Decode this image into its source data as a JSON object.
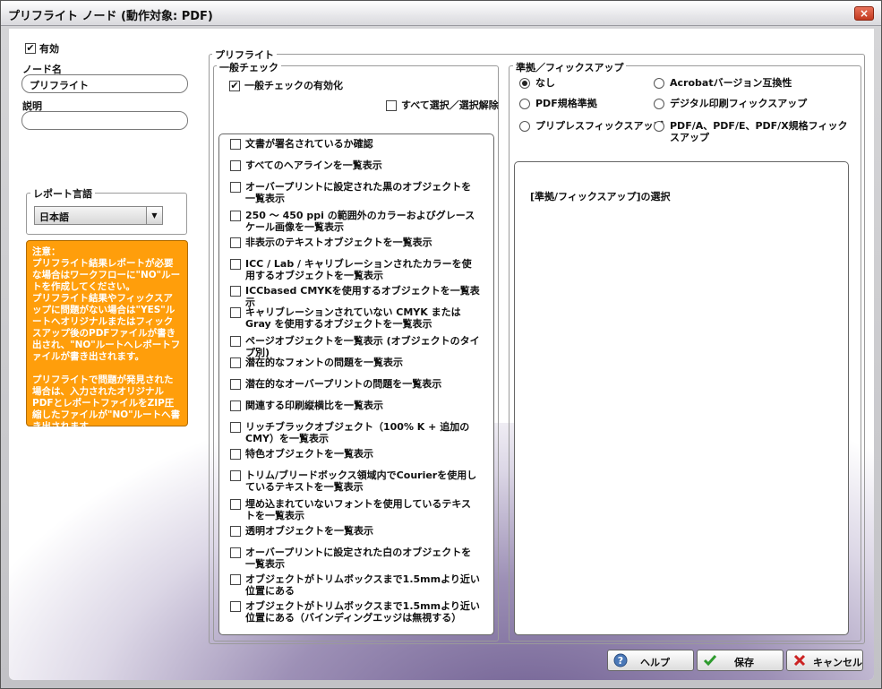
{
  "window": {
    "title": "プリフライト ノード (動作対象: PDF)",
    "close_symbol": "×"
  },
  "left": {
    "enabled_label": "有効",
    "enabled_checked": true,
    "node_name_label": "ノード名",
    "node_name_value": "プリフライト",
    "description_label": "説明",
    "description_value": "",
    "report_lang_title": "レポート言語",
    "report_lang_value": "日本語",
    "note_text": "注意：\nプリフライト結果レポートが必要な場合はワークフローに\"NO\"ルートを作成してください。\nプリフライト結果やフィックスアップに問題がない場合は\"YES\"ルートへオリジナルまたはフィックスアップ後のPDFファイルが書き出され、\"NO\"ルートへレポートファイルが書き出されます。\n\nプリフライトで問題が発見された場合は、入力されたオリジナルPDFとレポートファイルをZIP圧縮したファイルが\"NO\"ルートへ書き出されます。"
  },
  "preflight": {
    "title": "プリフライト",
    "general": {
      "title": "一般チェック",
      "enable_label": "一般チェックの有効化",
      "enable_checked": true,
      "select_all_label": "すべて選択／選択解除",
      "items": [
        "文書が署名されているか確認",
        "すべてのヘアラインを一覧表示",
        "オーバープリントに設定された黒のオブジェクトを一覧表示",
        "250 ～ 450 ppi の範囲外のカラーおよびグレースケール画像を一覧表示",
        "非表示のテキストオブジェクトを一覧表示",
        "ICC / Lab / キャリブレーションされたカラーを使用するオブジェクトを一覧表示",
        "ICCbased CMYKを使用するオブジェクトを一覧表示",
        "キャリブレーションされていない CMYK または Gray を使用するオブジェクトを一覧表示",
        "ページオブジェクトを一覧表示 (オブジェクトのタイプ別)",
        "潜在的なフォントの問題を一覧表示",
        "潜在的なオーバープリントの問題を一覧表示",
        "関連する印刷縦横比を一覧表示",
        "リッチブラックオブジェクト（100% K + 追加のCMY）を一覧表示",
        "特色オブジェクトを一覧表示",
        "トリム/ブリードボックス領域内でCourierを使用しているテキストを一覧表示",
        "埋め込まれていないフォントを使用しているテキストを一覧表示",
        "透明オブジェクトを一覧表示",
        "オーバープリントに設定された白のオブジェクトを一覧表示",
        "オブジェクトがトリムボックスまで1.5mmより近い位置にある",
        "オブジェクトがトリムボックスまで1.5mmより近い位置にある（バインディングエッジは無視する）"
      ]
    },
    "fixup": {
      "title": "準拠／フィックスアップ",
      "options": [
        {
          "label": "なし",
          "selected": true
        },
        {
          "label": "Acrobatバージョン互換性",
          "selected": false
        },
        {
          "label": "PDF規格準拠",
          "selected": false
        },
        {
          "label": "デジタル印刷フィックスアップ",
          "selected": false
        },
        {
          "label": "プリプレスフィックスアップ",
          "selected": false
        },
        {
          "label": "PDF/A、PDF/E、PDF/X規格フィックスアップ",
          "selected": false
        }
      ],
      "panel_text": "[準拠/フィックスアップ]の選択"
    }
  },
  "buttons": {
    "help": "ヘルプ",
    "save": "保存",
    "cancel": "キャンセル"
  }
}
